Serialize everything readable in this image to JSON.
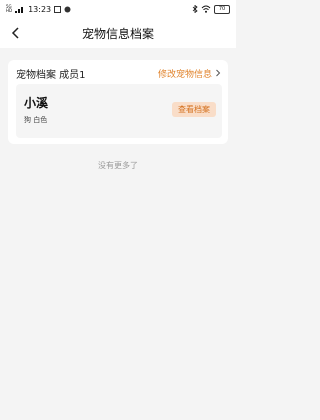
{
  "status_bar": {
    "carrier_top": "5G",
    "carrier_bottom": "HD",
    "time": "13:23",
    "battery": "70"
  },
  "header": {
    "title": "宠物信息档案"
  },
  "card": {
    "title": "宠物档案 成员1",
    "edit_label": "修改宠物信息"
  },
  "pet": {
    "name": "小溪",
    "description": "狗 白色",
    "view_label": "查看档案"
  },
  "footer_note": "没有更多了",
  "colors": {
    "accent": "#e0822a",
    "button_bg": "#f9ddc8"
  }
}
